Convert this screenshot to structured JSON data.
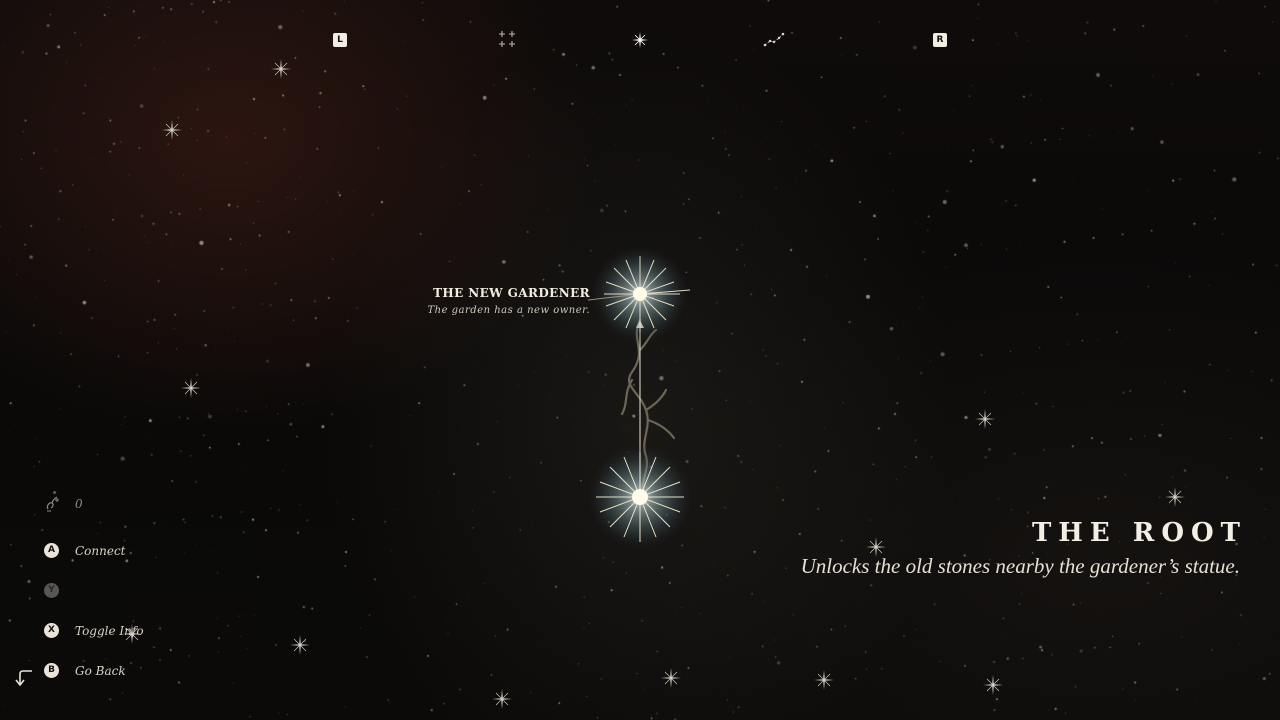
{
  "top_nav": {
    "left_shoulder": "L",
    "right_shoulder": "R",
    "tabs": [
      {
        "icon": "four-stars-icon"
      },
      {
        "icon": "single-star-icon",
        "selected": true
      },
      {
        "icon": "constellation-icon"
      }
    ]
  },
  "constellation": {
    "node": {
      "title": "THE NEW GARDENER",
      "description": "The garden has a new owner."
    }
  },
  "info_panel": {
    "title": "THE ROOT",
    "description": "Unlocks the old stones nearby the gardener’s statue."
  },
  "controls": {
    "counter": {
      "icon": "seed-icon",
      "value": "0"
    },
    "buttons": [
      {
        "glyph": "A",
        "label": "Connect",
        "enabled": true
      },
      {
        "glyph": "Y",
        "label": "",
        "enabled": false
      },
      {
        "glyph": "X",
        "label": "Toggle Info",
        "enabled": true
      },
      {
        "glyph": "B",
        "label": "Go Back",
        "enabled": true
      }
    ],
    "back_icon": "return-arrow-icon"
  },
  "colors": {
    "background": "#0b0908",
    "text": "#f1ece2",
    "star_glow": "#9fb7c0",
    "root_line": "#8a7f6a"
  }
}
